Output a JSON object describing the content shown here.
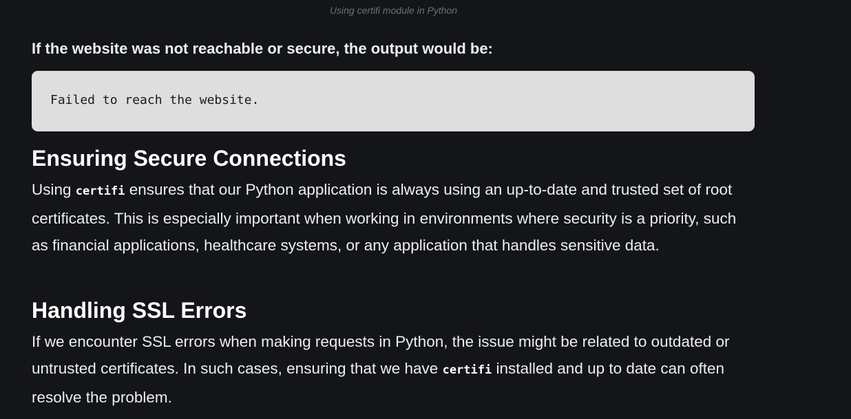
{
  "caption": "Using certifi module in Python",
  "lead_text": "If the website was not reachable or secure, the output would be:",
  "code_output": "Failed to reach the website.",
  "section_secure": {
    "heading": "Ensuring Secure Connections",
    "p_before": "Using ",
    "code": "certifi",
    "p_after": " ensures that our Python application is always using an up-to-date and trusted set of root certificates. This is especially important when working in environments where security is a priority, such as financial applications, healthcare systems, or any application that handles sensitive data."
  },
  "section_ssl": {
    "heading": "Handling SSL Errors",
    "p_before": "If we encounter SSL errors when making requests in Python, the issue might be related to outdated or untrusted certificates. In such cases, ensuring that we have ",
    "code": "certifi",
    "p_after": " installed and up to date can often resolve the problem."
  }
}
